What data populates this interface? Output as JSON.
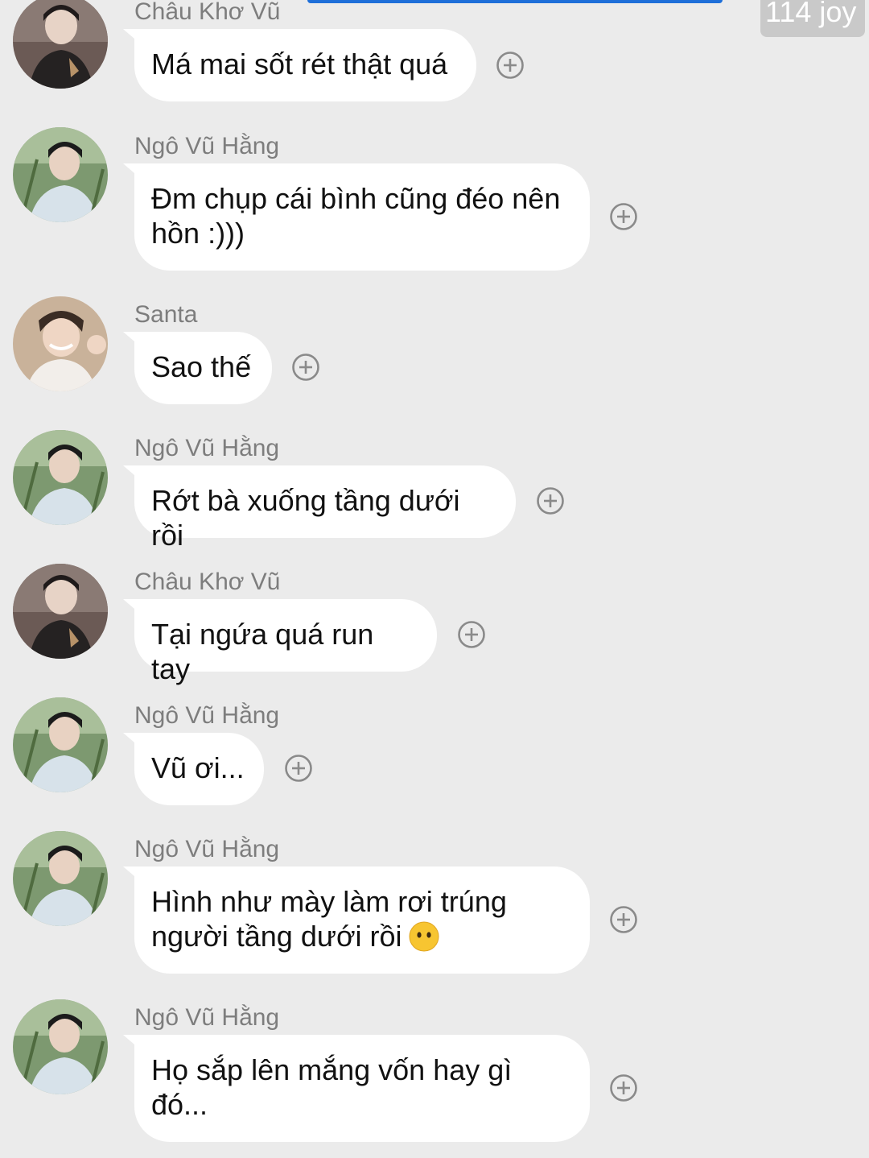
{
  "header": {
    "timestamp_fragment": "114 joy"
  },
  "messages": [
    {
      "sender": "Châu Khơ Vũ",
      "text": "Má mai sốt rét thật quá",
      "avatar": "avatar-chau"
    },
    {
      "sender": "Ngô Vũ Hằng",
      "text": "Đm chụp cái bình cũng đéo nên hồn :)))",
      "avatar": "avatar-hang"
    },
    {
      "sender": "Santa",
      "text": "Sao thế",
      "avatar": "avatar-santa"
    },
    {
      "sender": "Ngô Vũ Hằng",
      "text": "Rớt bà xuống tầng dưới rồi",
      "avatar": "avatar-hang"
    },
    {
      "sender": "Châu Khơ Vũ",
      "text": "Tại ngứa quá run tay",
      "avatar": "avatar-chau"
    },
    {
      "sender": "Ngô Vũ Hằng",
      "text": "Vũ ơi...",
      "avatar": "avatar-hang"
    },
    {
      "sender": "Ngô Vũ Hằng",
      "text": "Hình như mày làm rơi trúng người tầng dưới rồi",
      "emoji": "neutral-face-emoji",
      "avatar": "avatar-hang"
    },
    {
      "sender": "Ngô Vũ Hằng",
      "text": "Họ sắp lên mắng vốn hay gì đó...",
      "avatar": "avatar-hang"
    }
  ],
  "icons": {
    "reaction": "add-reaction-icon"
  },
  "colors": {
    "background": "#ebebeb",
    "bubble": "#ffffff",
    "sender_text": "#7d7d7d",
    "message_text": "#111111",
    "reaction_icon": "#8a8a8a",
    "accent_bar": "#1e6fd9"
  }
}
